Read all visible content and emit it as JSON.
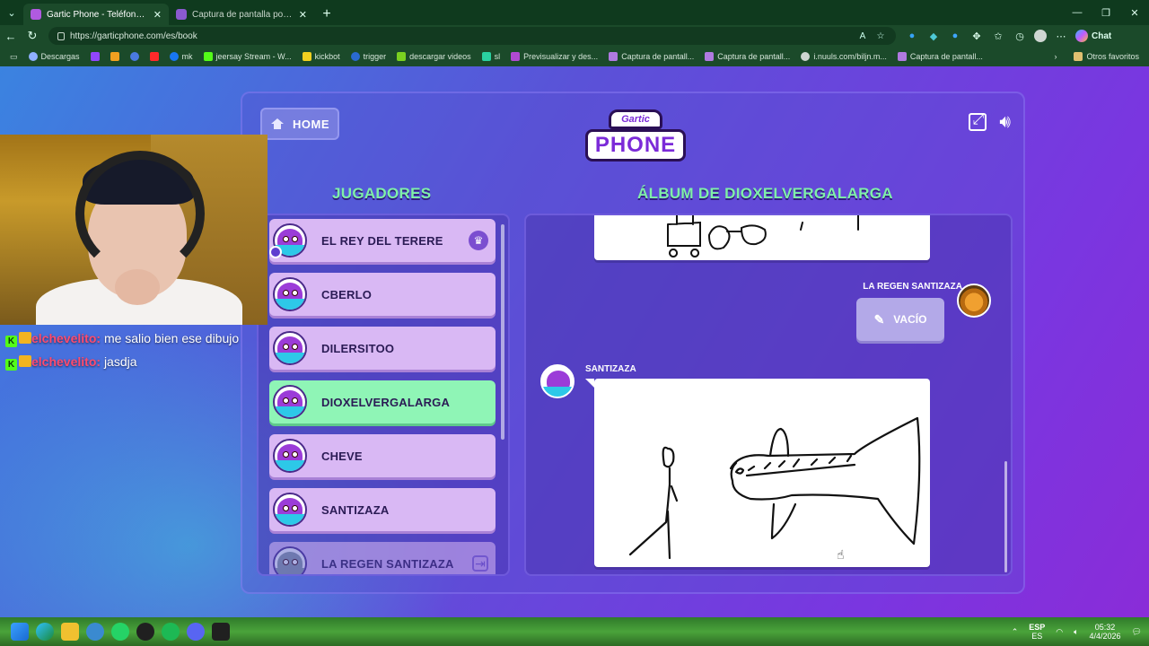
{
  "browser": {
    "tabs": [
      {
        "title": "Gartic Phone - Teléfono Descompuesto",
        "active": true
      },
      {
        "title": "Captura de pantalla por Lightshot",
        "active": false
      }
    ],
    "url": "https://garticphone.com/es/book",
    "copilot_label": "Chat",
    "bookmarks": [
      "Descargas",
      "mk",
      "jeersay Stream - W...",
      "kickbot",
      "trigger",
      "descargar videos",
      "sl",
      "Previsualizar y des...",
      "Captura de pantall...",
      "Captura de pantall...",
      "i.nuuls.com/biljn.m...",
      "Captura de pantall..."
    ],
    "bookmarks_other": "Otros favoritos"
  },
  "game": {
    "home_label": "HOME",
    "logo_top": "Gartic",
    "logo_main": "PHONE",
    "players_title": "JUGADORES",
    "album_title": "ÁLBUM DE DIOXELVERGALARGA",
    "players": [
      {
        "name": "EL REY DEL TERERE",
        "badge": "owner"
      },
      {
        "name": "CBERLO"
      },
      {
        "name": "DILERSITOO"
      },
      {
        "name": "DIOXELVERGALARGA",
        "highlight": true
      },
      {
        "name": "CHEVE"
      },
      {
        "name": "SANTIZAZA"
      },
      {
        "name": "LA REGEN SANTIZAZA",
        "badge": "exit",
        "faded": true
      }
    ],
    "album": {
      "entry1_author": "LA REGEN SANTIZAZA",
      "entry1_text": "VACÍO",
      "entry2_author": "SANTIZAZA"
    }
  },
  "chat": [
    {
      "user": "elchevelito",
      "message": "me salio bien ese dibujo"
    },
    {
      "user": "elchevelito",
      "message": "jasdja"
    }
  ],
  "taskbar": {
    "lang_top": "ESP",
    "lang_bottom": "ES",
    "time": "05:32",
    "date": "4/4/2026"
  },
  "colors": {
    "accent_green": "#7ff0a8",
    "player_card": "#d9b8f4",
    "player_highlight": "#8ff5b6",
    "chat_user": "#ff4b6e"
  }
}
